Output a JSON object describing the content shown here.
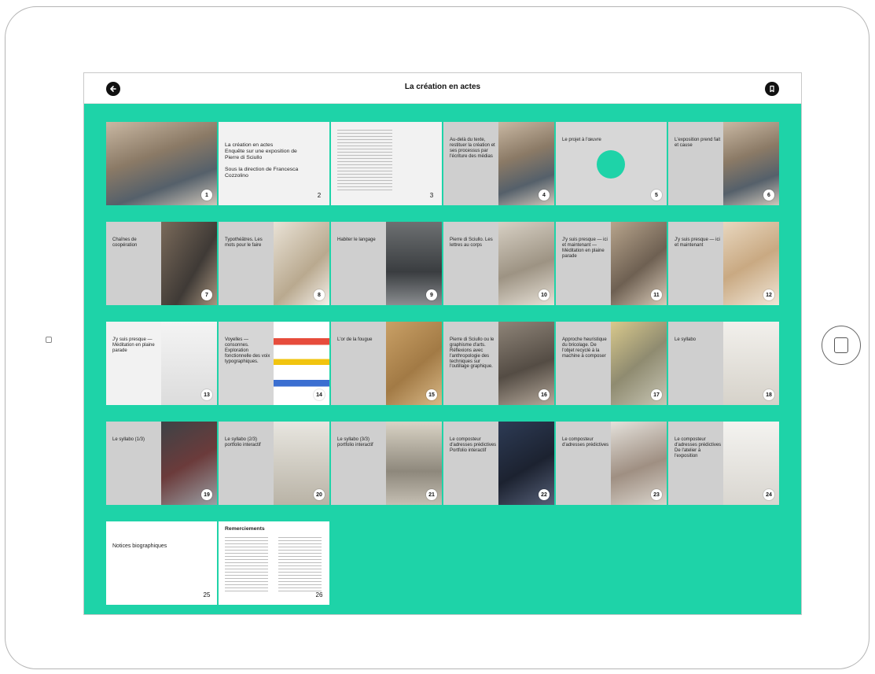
{
  "app": {
    "title": "La création en actes",
    "back_icon": "arrow-left-icon",
    "bookmark_icon": "bookmark-icon",
    "accent_color": "#1ed3a8"
  },
  "pages": [
    {
      "num": "1",
      "text": "",
      "photo": "workshop"
    },
    {
      "num": "2",
      "text": "La création en actes\nEnquête sur une exposition de Pierre di Sciullo\n\nSous la direction de Francesca Cozzolino",
      "photo": ""
    },
    {
      "num": "3",
      "text": "",
      "photo": ""
    },
    {
      "num": "4",
      "text": "Au-delà du texte, restituer la création et ses processus par l'écriture des médias",
      "photo": "workshop"
    },
    {
      "num": "5",
      "text": "Le projet à l'œuvre",
      "photo": "circle"
    },
    {
      "num": "6",
      "text": "L'exposition prend fait et cause",
      "photo": "workshop"
    },
    {
      "num": "7",
      "text": "Chaînes de coopération",
      "photo": "people"
    },
    {
      "num": "8",
      "text": "Typothéâtres. Les mots pour le faire",
      "photo": "paper"
    },
    {
      "num": "9",
      "text": "Habiter le langage",
      "photo": "gallery"
    },
    {
      "num": "10",
      "text": "Pierre di Sciullo. Les lettres au corps",
      "photo": "table"
    },
    {
      "num": "11",
      "text": "J'y suis presque — ici et maintenant — Méditation en plaine parade",
      "photo": "crowd"
    },
    {
      "num": "12",
      "text": "J'y suis presque — ici et maintenant",
      "photo": "wood"
    },
    {
      "num": "13",
      "text": "J'y suis presque — Méditation en plaine parade",
      "photo": "letters"
    },
    {
      "num": "14",
      "text": "Voyelles — consonnes. Exploration fonctionnelle des voix typographiques.",
      "photo": "colors"
    },
    {
      "num": "15",
      "text": "L'or de la fougue",
      "photo": "cork"
    },
    {
      "num": "16",
      "text": "Pierre di Sciullo ou le graphisme d'arts. Réflexions avec l'anthropologie des techniques sur l'outillage graphique.",
      "photo": "desk"
    },
    {
      "num": "17",
      "text": "Approche heuristique du bricolage. De l'objet recyclé à la machine à composer",
      "photo": "machine"
    },
    {
      "num": "18",
      "text": "Le syllabo",
      "photo": "wall"
    },
    {
      "num": "19",
      "text": "Le syllabo (1/3)",
      "photo": "red-machine"
    },
    {
      "num": "20",
      "text": "Le syllabo (2/3) portfolio interactif",
      "photo": "room"
    },
    {
      "num": "21",
      "text": "Le syllabo (3/3) portfolio interactif",
      "photo": "hall"
    },
    {
      "num": "22",
      "text": "Le composteur d'adresses prédictives Portfolio interactif",
      "photo": "sign"
    },
    {
      "num": "23",
      "text": "Le composteur d'adresses prédictives",
      "photo": "person"
    },
    {
      "num": "24",
      "text": "Le composteur d'adresses prédictives De l'atelier à l'exposition",
      "photo": "white"
    },
    {
      "num": "25",
      "text": "Notices biographiques",
      "photo": "plain"
    },
    {
      "num": "26",
      "text": "Remerciements",
      "photo": "text"
    }
  ]
}
